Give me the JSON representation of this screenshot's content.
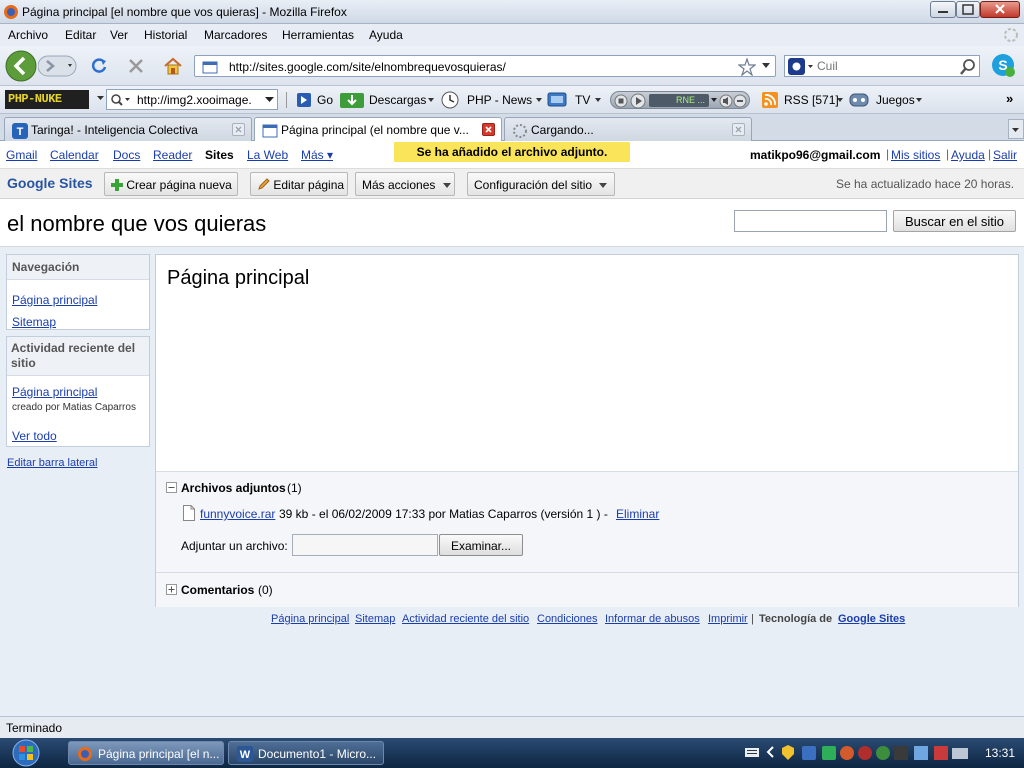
{
  "window": {
    "title": "Página principal [el nombre que vos quieras] - Mozilla Firefox"
  },
  "menu": [
    "Archivo",
    "Editar",
    "Ver",
    "Historial",
    "Marcadores",
    "Herramientas",
    "Ayuda"
  ],
  "navbar": {
    "url": "http://sites.google.com/site/elnombrequevosquieras/",
    "search_placeholder": "Cuil"
  },
  "bookmarks": {
    "logo": "PHP-NUKE",
    "combo_value": "http://img2.xooimage.",
    "go": "Go",
    "descargas": "Descargas",
    "php_news": "PHP - News",
    "tv": "TV",
    "radio": "RNE ...",
    "rss": "RSS [571]",
    "juegos": "Juegos",
    "more": "»"
  },
  "tabs": [
    {
      "label": "Taringa! - Inteligencia Colectiva",
      "selected": false
    },
    {
      "label": "Página principal (el nombre que v...",
      "selected": true
    },
    {
      "label": "Cargando...",
      "selected": false
    }
  ],
  "google_bar": {
    "links": [
      "Gmail",
      "Calendar",
      "Docs",
      "Reader",
      "Sites",
      "La Web",
      "Más ▾"
    ],
    "notice": "Se ha añadido el archivo adjunto.",
    "email": "matikpo96@gmail.com",
    "account_links": [
      "Mis sitios",
      "Ayuda",
      "Salir"
    ]
  },
  "site_toolbar": {
    "brand": "Google Sites",
    "create": "Crear página nueva",
    "edit": "Editar página",
    "more": "Más acciones",
    "config": "Configuración del sitio",
    "updated": "Se ha actualizado hace 20 horas."
  },
  "site": {
    "title": "el nombre que vos quieras",
    "search_button": "Buscar en el sitio"
  },
  "sidebar": {
    "nav_title": "Navegación",
    "nav_links": [
      "Página principal",
      "Sitemap"
    ],
    "activity_title": "Actividad reciente del sitio",
    "activity_link": "Página principal",
    "activity_meta": "creado por Matias Caparros",
    "view_all": "Ver todo",
    "edit_sidebar": "Editar barra lateral"
  },
  "main": {
    "page_title": "Página principal",
    "attachments_label": "Archivos adjuntos",
    "attachments_count": "(1)",
    "file_name": "funnyvoice.rar",
    "file_meta": "39 kb - el 06/02/2009 17:33 por Matias Caparros (versión 1 ) -",
    "file_delete": "Eliminar",
    "attach_label": "Adjuntar un archivo:",
    "browse_button": "Examinar...",
    "comments_label": "Comentarios",
    "comments_count": "(0)"
  },
  "footer": {
    "links": [
      "Página principal",
      "Sitemap",
      "Actividad reciente del sitio",
      "Condiciones",
      "Informar de abusos",
      "Imprimir"
    ],
    "tech_label": "Tecnología de",
    "tech_link": "Google Sites"
  },
  "status": "Terminado",
  "taskbar": {
    "tasks": [
      "Página principal [el n...",
      "Documento1 - Micro..."
    ],
    "clock": "13:31"
  },
  "colors": {
    "link": "#1a3dad",
    "notice_bg": "#f9e45a",
    "brand": "#2855a0"
  }
}
